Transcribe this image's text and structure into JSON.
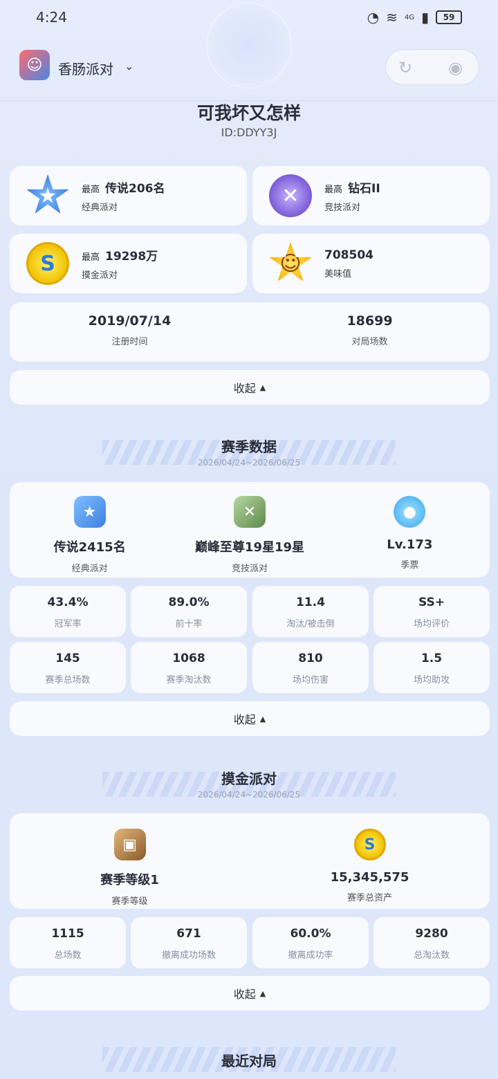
{
  "status_bar": {
    "time": "4:24",
    "network": "4G",
    "battery": "59"
  },
  "topbar": {
    "app_name": "香肠派对"
  },
  "profile": {
    "name": "可我坏又怎样",
    "id": "ID:DDYY3J"
  },
  "rank_cards": [
    {
      "prefix": "最高",
      "value": "传说206名",
      "label": "经典派对",
      "icon": "star-badge-icon"
    },
    {
      "prefix": "最高",
      "value": "钻石II",
      "label": "竞技派对",
      "icon": "diamond-badge-icon"
    },
    {
      "prefix": "最高",
      "value": "19298万",
      "label": "摸金派对",
      "icon": "coin-icon"
    },
    {
      "prefix": "",
      "value": "708504",
      "label": "美味值",
      "icon": "smiley-star-icon"
    }
  ],
  "register": {
    "date": "2019/07/14",
    "date_label": "注册时间",
    "matches": "18699",
    "matches_label": "对局场数"
  },
  "collapse_label": "收起",
  "season": {
    "title": "赛季数据",
    "date_range": "2026/04/24~2026/06/25",
    "summary": [
      {
        "value": "传说2415名",
        "label": "经典派对",
        "icon": "star-badge-icon"
      },
      {
        "value": "巅峰至尊19星19星",
        "label": "竞技派对",
        "icon": "crossed-guns-icon"
      },
      {
        "value": "Lv.173",
        "label": "季票",
        "icon": "bird-icon"
      }
    ],
    "stats": [
      {
        "value": "43.4%",
        "label": "冠军率"
      },
      {
        "value": "89.0%",
        "label": "前十率"
      },
      {
        "value": "11.4",
        "label": "淘汰/被击倒"
      },
      {
        "value": "SS+",
        "label": "场均评价"
      },
      {
        "value": "145",
        "label": "赛季总场数"
      },
      {
        "value": "1068",
        "label": "赛季淘汰数"
      },
      {
        "value": "810",
        "label": "场均伤害"
      },
      {
        "value": "1.5",
        "label": "场均助攻"
      }
    ]
  },
  "gold_party": {
    "title": "摸金派对",
    "date_range": "2026/04/24~2026/06/25",
    "summary": [
      {
        "value": "赛季等级1",
        "label": "赛季等级",
        "icon": "chest-icon"
      },
      {
        "value": "15,345,575",
        "label": "赛季总资产",
        "icon": "coin-icon"
      }
    ],
    "stats": [
      {
        "value": "1115",
        "label": "总场数"
      },
      {
        "value": "671",
        "label": "撤离成功场数"
      },
      {
        "value": "60.0%",
        "label": "撤离成功率"
      },
      {
        "value": "9280",
        "label": "总淘汰数"
      }
    ]
  },
  "recent": {
    "title": "最近对局"
  }
}
